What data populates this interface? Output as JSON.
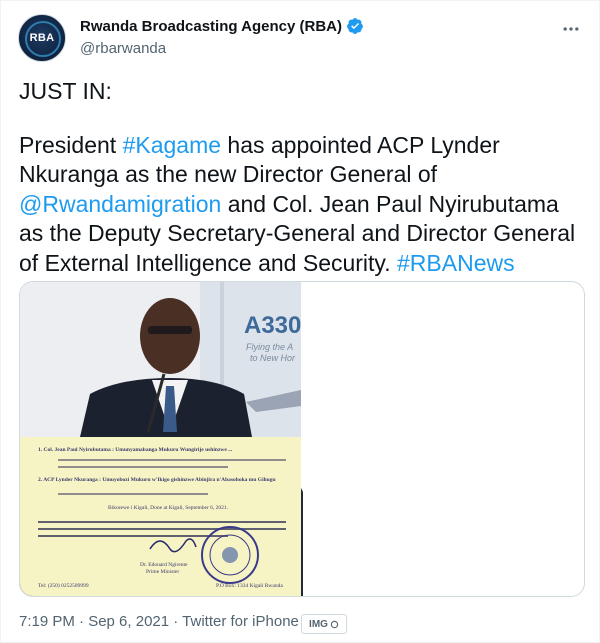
{
  "account": {
    "display_name": "Rwanda Broadcasting Agency (RBA)",
    "handle": "@rbarwanda",
    "avatar_text": "RBA",
    "verified": true
  },
  "tweet": {
    "line1": "JUST IN:",
    "seg_a": "President ",
    "hashtag_kagame": "#Kagame",
    "seg_b": " has appointed ACP Lynder Nkuranga as the new Director General of ",
    "mention": "@Rwandamigration",
    "seg_c": " and Col. Jean Paul Nyirubutama as the Deputy Secretary-General and Director General of External Intelligence and Security. ",
    "hashtag_rba": "#RBANews"
  },
  "media": {
    "right_top_sign": "A330",
    "right_top_sub1": "Flying the A",
    "right_top_sub2": "to New Hor",
    "doc": {
      "item1": "1. Col. Jean Paul Nyirubutama : Umunyamabanga Mukuru Wungirije ushinzwe ...",
      "item2": "2. ACP Lynder Nkuranga : Umuyobozi Mukuru w'Ikigo gishinzwe Abinjira n'Abasohoka mu Gihugu",
      "place": "Bikorewe i Kigali, Done at Kigali, September 6, 2021.",
      "signer": "Dr. Edouard Ngirente",
      "role": "Prime Minister",
      "footer_left": "Tel: (250) 0252589999",
      "footer_right": "P.O Box: 1334 Kigali Rwanda"
    }
  },
  "footer": {
    "timestamp": "7:19 PM · Sep 6, 2021 · Twitter for iPhone",
    "badge": "IMG"
  },
  "colors": {
    "link": "#1d9bf0",
    "verified": "#1d9bf0",
    "secondary_text": "#536471"
  }
}
